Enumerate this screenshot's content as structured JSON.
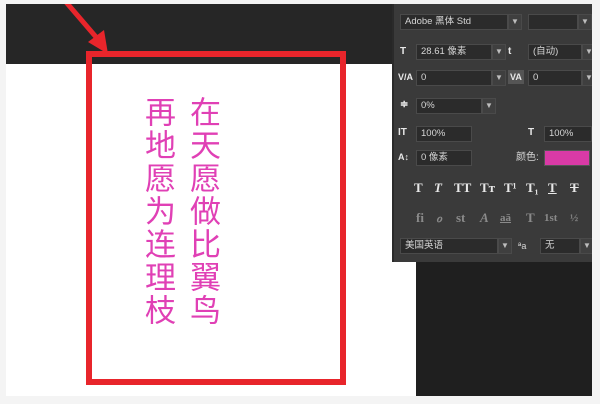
{
  "canvas": {
    "text_column_1": "在天愿做比翼鸟",
    "text_column_2": "再地愿为连理枝"
  },
  "character_panel": {
    "font_family": "Adobe 黑体 Std",
    "font_size": "28.61 像素",
    "leading": "(自动)",
    "kerning": "0",
    "tracking": "0",
    "tsume": "0%",
    "vertical_scale": "100%",
    "horizontal_scale": "100%",
    "baseline_shift": "0 像素",
    "color_label": "颜色:",
    "color_value": "#d93aa6",
    "language": "美国英语",
    "anti_alias_label": "ªa",
    "anti_alias": "无",
    "style_buttons": [
      "T",
      "T",
      "TT",
      "Tт",
      "T¹",
      "T₁",
      "T",
      "T"
    ],
    "opentype_buttons": [
      "fi",
      "ℴ",
      "st",
      "A",
      "aā",
      "T",
      "1st",
      "½"
    ],
    "icons": {
      "size": "font-size-icon",
      "leading": "leading-icon",
      "kerning": "kerning-icon",
      "tracking": "tracking-icon",
      "tsume": "tsume-icon",
      "vscale": "vertical-scale-icon",
      "hscale": "horizontal-scale-icon",
      "baseline": "baseline-shift-icon"
    }
  },
  "colors": {
    "text_pink": "#e040b5",
    "highlight_red": "#e8252b",
    "panel_bg": "#3a3a3a"
  }
}
